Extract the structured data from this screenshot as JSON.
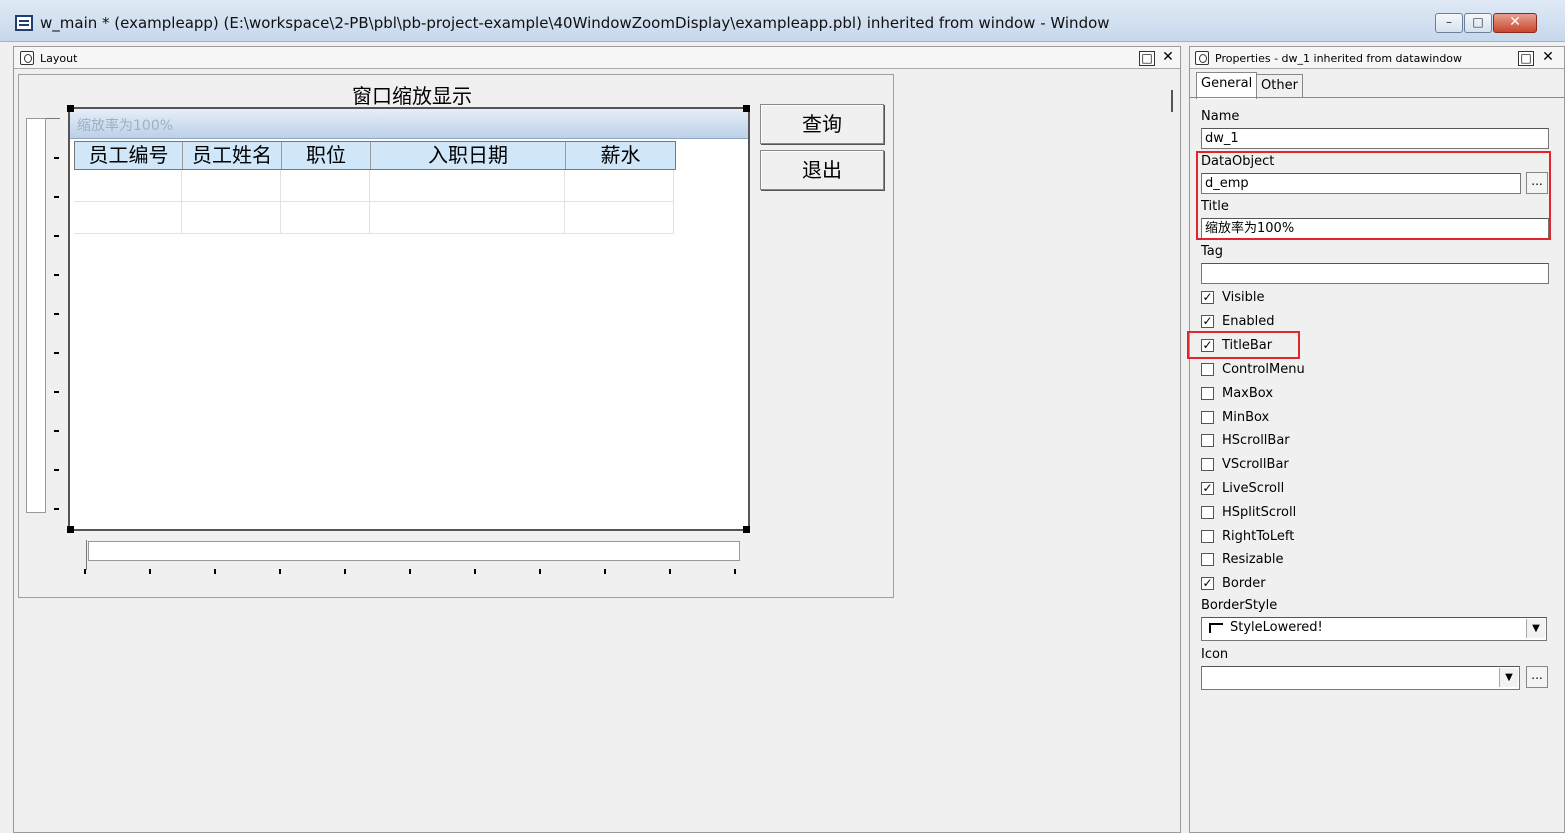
{
  "window": {
    "title": "w_main * (exampleapp) (E:\\workspace\\2-PB\\pbl\\pb-project-example\\40WindowZoomDisplay\\exampleapp.pbl) inherited from window - Window",
    "min_glyph": "–",
    "max_glyph": "□",
    "close_glyph": "✕"
  },
  "layout": {
    "label": "Layout",
    "restore_glyph": "□",
    "close_glyph": "✕",
    "window_title": "窗口缩放显示",
    "dw_title": "缩放率为100%",
    "columns": [
      "员工编号",
      "员工姓名",
      "职位",
      "入职日期",
      "薪水"
    ],
    "buttons": {
      "query": "查询",
      "exit": "退出"
    }
  },
  "properties": {
    "label": "Properties - dw_1 inherited from datawindow",
    "restore_glyph": "□",
    "close_glyph": "✕",
    "tabs": [
      "General",
      "Other"
    ],
    "name_label": "Name",
    "name_value": "dw_1",
    "dataobject_label": "DataObject",
    "dataobject_value": "d_emp",
    "ellipsis": "...",
    "title_label": "Title",
    "title_value": "缩放率为100%",
    "tag_label": "Tag",
    "tag_value": "",
    "check_mark": "✓",
    "checkboxes": [
      {
        "label": "Visible",
        "checked": true
      },
      {
        "label": "Enabled",
        "checked": true
      },
      {
        "label": "TitleBar",
        "checked": true
      },
      {
        "label": "ControlMenu",
        "checked": false
      },
      {
        "label": "MaxBox",
        "checked": false
      },
      {
        "label": "MinBox",
        "checked": false
      },
      {
        "label": "HScrollBar",
        "checked": false
      },
      {
        "label": "VScrollBar",
        "checked": false
      },
      {
        "label": "LiveScroll",
        "checked": true
      },
      {
        "label": "HSplitScroll",
        "checked": false
      },
      {
        "label": "RightToLeft",
        "checked": false
      },
      {
        "label": "Resizable",
        "checked": false
      },
      {
        "label": "Border",
        "checked": true
      }
    ],
    "borderstyle_label": "BorderStyle",
    "borderstyle_value": "StyleLowered!",
    "icon_label": "Icon",
    "icon_value": "",
    "combo_arrow": "▼"
  },
  "colors": {
    "highlight": "#e0262c",
    "grid_header": "#cfe7f9"
  }
}
